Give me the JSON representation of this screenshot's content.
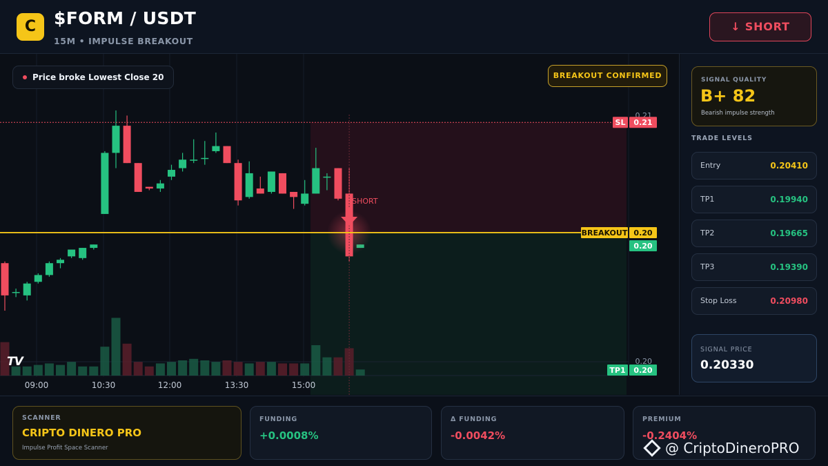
{
  "header": {
    "logo_letter": "C",
    "pair": "$FORM / USDT",
    "subtitle": "15M • IMPULSE BREAKOUT",
    "direction_label": "↓ SHORT"
  },
  "chart": {
    "event_text": "Price broke Lowest Close 20",
    "status_badge": "BREAKOUT CONFIRMED",
    "signal_marker_label": "SHORT",
    "watermark_logo": "TV",
    "level_labels": {
      "sl": "SL",
      "breakout": "BREAKOUT",
      "tp1": "TP1"
    },
    "price_tags": {
      "axis_top": "0.21",
      "sl": "0.21",
      "breakout": "0.20",
      "last": "0.20",
      "axis_bottom": "0.20",
      "tp1": "0.20"
    },
    "colors": {
      "bull": "#26c281",
      "bear": "#f04d5f",
      "breakout": "#f5c518"
    }
  },
  "chart_data": {
    "type": "candlestick",
    "timeframe": "15M",
    "x_ticks": [
      "09:00",
      "10:30",
      "12:00",
      "13:30",
      "15:00"
    ],
    "candles": [
      {
        "o": 0.2015,
        "h": 0.2016,
        "l": 0.1987,
        "c": 0.1996
      },
      {
        "o": 0.1998,
        "h": 0.2,
        "l": 0.1995,
        "c": 0.1998
      },
      {
        "o": 0.1996,
        "h": 0.2004,
        "l": 0.1993,
        "c": 0.2003
      },
      {
        "o": 0.2004,
        "h": 0.2009,
        "l": 0.2003,
        "c": 0.2008
      },
      {
        "o": 0.2008,
        "h": 0.2016,
        "l": 0.2007,
        "c": 0.2015
      },
      {
        "o": 0.2015,
        "h": 0.2018,
        "l": 0.2012,
        "c": 0.2017
      },
      {
        "o": 0.2019,
        "h": 0.2023,
        "l": 0.2018,
        "c": 0.2023
      },
      {
        "o": 0.2018,
        "h": 0.2024,
        "l": 0.2017,
        "c": 0.2024
      },
      {
        "o": 0.2024,
        "h": 0.2026,
        "l": 0.2023,
        "c": 0.2026
      },
      {
        "o": 0.2044,
        "h": 0.2081,
        "l": 0.2044,
        "c": 0.208
      },
      {
        "o": 0.208,
        "h": 0.2105,
        "l": 0.2071,
        "c": 0.2096
      },
      {
        "o": 0.2096,
        "h": 0.2102,
        "l": 0.2074,
        "c": 0.2074
      },
      {
        "o": 0.2074,
        "h": 0.2074,
        "l": 0.2057,
        "c": 0.2057
      },
      {
        "o": 0.206,
        "h": 0.206,
        "l": 0.2058,
        "c": 0.2059
      },
      {
        "o": 0.2059,
        "h": 0.2064,
        "l": 0.2057,
        "c": 0.2062
      },
      {
        "o": 0.2066,
        "h": 0.2073,
        "l": 0.2064,
        "c": 0.207
      },
      {
        "o": 0.2071,
        "h": 0.208,
        "l": 0.2069,
        "c": 0.2076
      },
      {
        "o": 0.2076,
        "h": 0.2088,
        "l": 0.2074,
        "c": 0.2076
      },
      {
        "o": 0.2077,
        "h": 0.2087,
        "l": 0.2073,
        "c": 0.2077
      },
      {
        "o": 0.2081,
        "h": 0.2092,
        "l": 0.208,
        "c": 0.2084
      },
      {
        "o": 0.2084,
        "h": 0.2084,
        "l": 0.2074,
        "c": 0.2074
      },
      {
        "o": 0.2074,
        "h": 0.2076,
        "l": 0.2049,
        "c": 0.2052
      },
      {
        "o": 0.2054,
        "h": 0.2075,
        "l": 0.2053,
        "c": 0.2068
      },
      {
        "o": 0.2059,
        "h": 0.2066,
        "l": 0.2056,
        "c": 0.2056
      },
      {
        "o": 0.2057,
        "h": 0.2069,
        "l": 0.2056,
        "c": 0.2069
      },
      {
        "o": 0.2068,
        "h": 0.2068,
        "l": 0.2056,
        "c": 0.2056
      },
      {
        "o": 0.2057,
        "h": 0.2057,
        "l": 0.2047,
        "c": 0.2054
      },
      {
        "o": 0.205,
        "h": 0.2064,
        "l": 0.2049,
        "c": 0.2056
      },
      {
        "o": 0.2056,
        "h": 0.2083,
        "l": 0.2056,
        "c": 0.2071
      },
      {
        "o": 0.2066,
        "h": 0.2068,
        "l": 0.2058,
        "c": 0.2066
      },
      {
        "o": 0.2071,
        "h": 0.2071,
        "l": 0.2052,
        "c": 0.2053
      },
      {
        "o": 0.2056,
        "h": 0.2071,
        "l": 0.2016,
        "c": 0.2019
      },
      {
        "o": 0.2024,
        "h": 0.2026,
        "l": 0.2024,
        "c": 0.2026
      }
    ],
    "volumes": [
      22,
      6,
      6,
      7,
      8,
      7,
      9,
      6,
      6,
      19,
      38,
      21,
      9,
      6,
      8,
      9,
      10,
      11,
      10,
      9,
      10,
      9,
      8,
      9,
      9,
      8,
      8,
      8,
      20,
      12,
      12,
      18,
      4
    ],
    "levels": {
      "sl": 0.2098,
      "breakout": 0.2033,
      "tp1": 0.1994
    },
    "y_axis_labels": [
      "0.21",
      "0.20"
    ],
    "signal_candle_index": 31
  },
  "sidebar": {
    "quality_label": "SIGNAL QUALITY",
    "quality_grade": "B+ 82",
    "quality_desc": "Bearish impulse strength",
    "levels_title": "TRADE LEVELS",
    "levels": [
      {
        "name": "Entry",
        "value": "0.20410",
        "color": "#f5c518"
      },
      {
        "name": "TP1",
        "value": "0.19940",
        "color": "#26c281"
      },
      {
        "name": "TP2",
        "value": "0.19665",
        "color": "#26c281"
      },
      {
        "name": "TP3",
        "value": "0.19390",
        "color": "#26c281"
      },
      {
        "name": "Stop Loss",
        "value": "0.20980",
        "color": "#f04d5f"
      }
    ],
    "signal_price_label": "SIGNAL PRICE",
    "signal_price": "0.20330"
  },
  "footer": {
    "scanner_label": "SCANNER",
    "scanner_name": "CRIPTO DINERO PRO",
    "scanner_desc": "Impulse Profit Space Scanner",
    "funding_label": "FUNDING",
    "funding_value": "+0.0008%",
    "delta_label": "Δ FUNDING",
    "delta_value": "-0.0042%",
    "premium_label": "PREMIUM",
    "premium_value": "-0.2404%",
    "watermark": "@ CriptoDineroPRO"
  }
}
